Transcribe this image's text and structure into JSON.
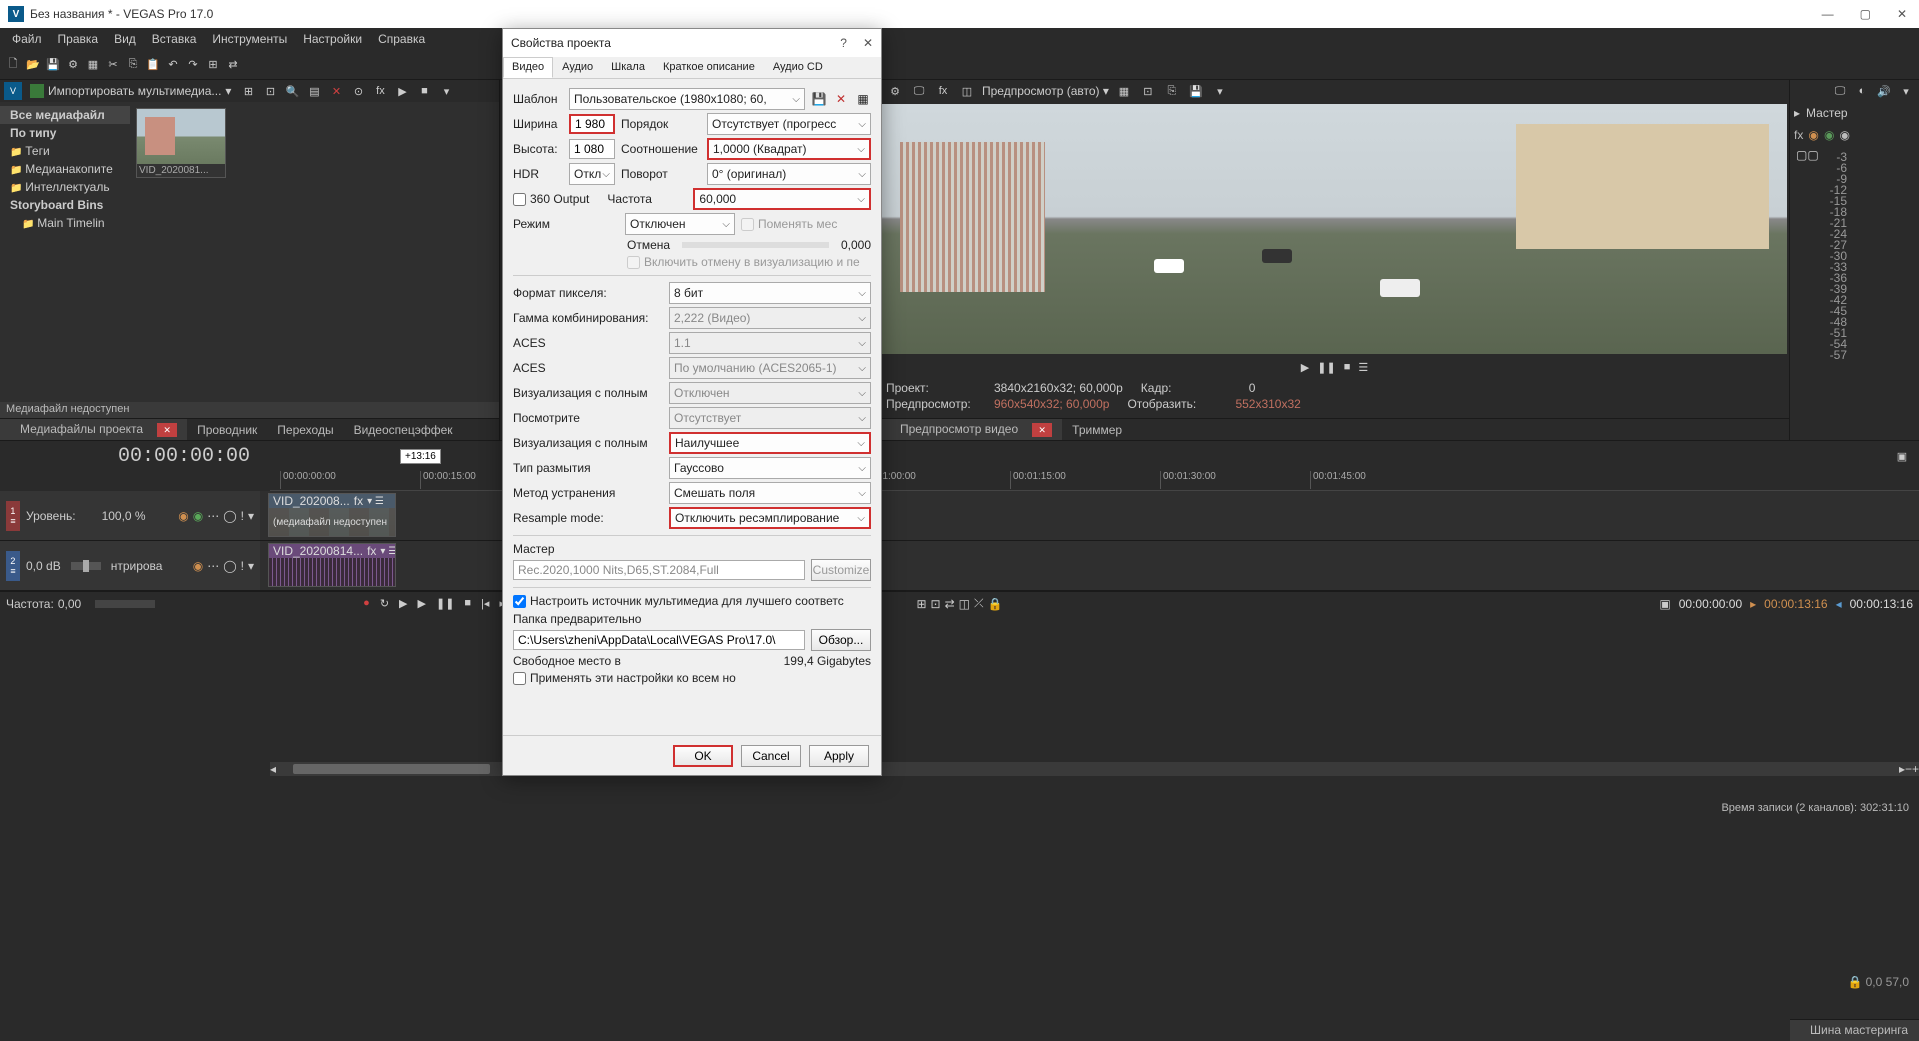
{
  "app": {
    "title": "Без названия * - VEGAS Pro 17.0"
  },
  "menu": [
    "Файл",
    "Правка",
    "Вид",
    "Вставка",
    "Инструменты",
    "Настройки",
    "Справка"
  ],
  "media": {
    "import": "Импортировать мультимедиа...",
    "tree": [
      "Все медиафайл",
      "По типу",
      "Теги",
      "Медианакопите",
      "Интеллектуаль",
      "Storyboard Bins",
      "Main Timelin"
    ],
    "thumb_caption": "VID_2020081...",
    "status": "Медиафайл недоступен"
  },
  "tabs_left": [
    "Медиафайлы проекта",
    "Проводник",
    "Переходы",
    "Видеоспецэффек"
  ],
  "preview": {
    "dd": "Предпросмотр (авто) ▾",
    "project_lbl": "Проект:",
    "project_val": "3840x2160x32; 60,000p",
    "frame_lbl": "Кадр:",
    "frame_val": "0",
    "prev_lbl": "Предпросмотр:",
    "prev_val": "960x540x32; 60,000p",
    "disp_lbl": "Отобразить:",
    "disp_val": "552x310x32",
    "tab1": "Предпросмотр видео",
    "tab2": "Триммер"
  },
  "master": {
    "title": "Мастер",
    "tab": "Шина мастеринга",
    "readout": "0,0    57,0"
  },
  "timeline": {
    "time": "00:00:00:00",
    "marker": "+13:16",
    "ticks": [
      "00:00:00:00",
      "00:00:15:00",
      "00:01:00:00",
      "00:01:15:00",
      "00:01:30:00",
      "00:01:45:00"
    ],
    "track_level_lbl": "Уровень:",
    "track_level_val": "100,0 %",
    "track_db": "0,0 dB",
    "track_center": "нтрирова",
    "clip1": "VID_202008...",
    "clip1_ovl": "(медиафайл недоступен",
    "clip2": "VID_20200814...",
    "rate_lbl": "Частота:",
    "rate_val": "0,00"
  },
  "transport_tc": [
    "00:00:00:00",
    "00:00:13:16",
    "00:00:13:16"
  ],
  "status": "Время записи (2 каналов): 302:31:10",
  "dialog": {
    "title": "Свойства проекта",
    "tabs": [
      "Видео",
      "Аудио",
      "Шкала",
      "Краткое описание",
      "Аудио CD"
    ],
    "template_lbl": "Шаблон",
    "template_val": "Пользовательское (1980x1080; 60,",
    "width_lbl": "Ширина",
    "width_val": "1 980",
    "height_lbl": "Высота:",
    "height_val": "1 080",
    "hdr_lbl": "HDR",
    "hdr_val": "Откл",
    "output360": "360 Output",
    "order_lbl": "Порядок",
    "order_val": "Отсутствует (прогресс",
    "aspect_lbl": "Соотношение",
    "aspect_val": "1,0000 (Квадрат)",
    "rot_lbl": "Поворот",
    "rot_val": "0° (оригинал)",
    "freq_lbl": "Частота",
    "freq_val": "60,000",
    "mode_lbl": "Режим",
    "mode_val": "Отключен",
    "swap": "Поменять мес",
    "cancel_lbl": "Отмена",
    "cancel_val": "0,000",
    "include_cancel": "Включить отмену в визуализацию и пе",
    "pixfmt_lbl": "Формат пикселя:",
    "pixfmt_val": "8 бит",
    "gamma_lbl": "Гамма комбинирования:",
    "gamma_val": "2,222 (Видео)",
    "aces1_lbl": "ACES",
    "aces1_val": "1.1",
    "aces2_lbl": "ACES",
    "aces2_val": "По умолчанию (ACES2065-1)",
    "viz1_lbl": "Визуализация с полным",
    "viz1_val": "Отключен",
    "look_lbl": "Посмотрите",
    "look_val": "Отсутствует",
    "viz2_lbl": "Визуализация с полным",
    "viz2_val": "Наилучшее",
    "blur_lbl": "Тип размытия",
    "blur_val": "Гауссово",
    "deint_lbl": "Метод устранения",
    "deint_val": "Смешать поля",
    "resample_lbl": "Resample mode:",
    "resample_val": "Отключить ресэмплирование",
    "master_lbl": "Мастер",
    "master_val": "Rec.2020,1000 Nits,D65,ST.2084,Full",
    "customize": "Customize",
    "adjust_src": "Настроить источник мультимедиа для лучшего соответс",
    "folder_lbl": "Папка предварительно",
    "folder_val": "C:\\Users\\zheni\\AppData\\Local\\VEGAS Pro\\17.0\\",
    "browse": "Обзор...",
    "free_lbl": "Свободное место в",
    "free_val": "199,4 Gigabytes",
    "apply_all": "Применять эти настройки ко всем нo",
    "ok": "OK",
    "cancel": "Cancel",
    "apply": "Apply"
  }
}
